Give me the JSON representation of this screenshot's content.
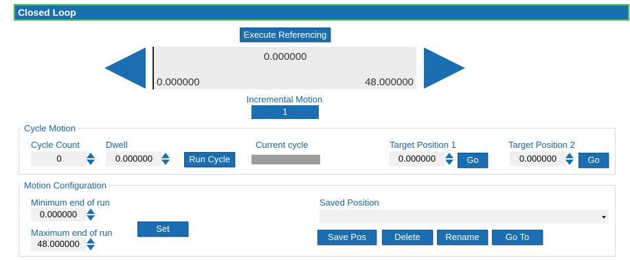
{
  "header": {
    "title": "Closed Loop"
  },
  "referencing": {
    "execute_label": "Execute Referencing"
  },
  "position": {
    "current": "0.000000",
    "min": "0.000000",
    "max": "48.000000"
  },
  "incremental": {
    "label": "Incremental Motion",
    "value": "1"
  },
  "cycle_motion": {
    "legend": "Cycle Motion",
    "cycle_count_label": "Cycle Count",
    "cycle_count_value": "0",
    "dwell_label": "Dwell",
    "dwell_value": "0.000000",
    "run_cycle_label": "Run Cycle",
    "current_cycle_label": "Current cycle",
    "target1_label": "Target Position 1",
    "target1_value": "0.000000",
    "target2_label": "Target Position 2",
    "target2_value": "0.000000",
    "go_label": "Go"
  },
  "motion_config": {
    "legend": "Motion Configuration",
    "min_label": "Minimum end of run",
    "min_value": "0.000000",
    "max_label": "Maximum end of run",
    "max_value": "48.000000",
    "set_label": "Set",
    "saved_position_label": "Saved Position",
    "saved_position_value": "",
    "save_pos_label": "Save Pos",
    "delete_label": "Delete",
    "rename_label": "Rename",
    "go_to_label": "Go To"
  },
  "colors": {
    "accent": "#1a6fb3",
    "header_border": "#43c34b",
    "label": "#1565a6"
  }
}
